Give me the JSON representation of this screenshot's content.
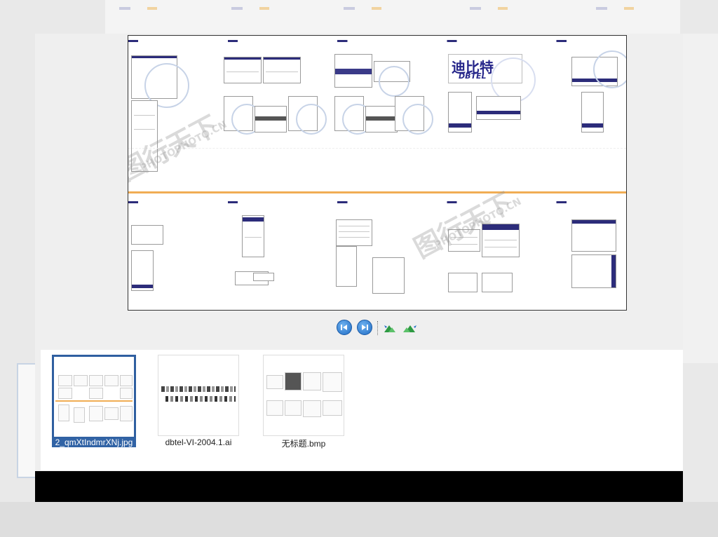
{
  "viewer": {
    "files": [
      {
        "name": "2_qmXtIndmrXNj.jpg",
        "selected": true
      },
      {
        "name": "dbtel-VI-2004.1.ai",
        "selected": false
      },
      {
        "name": "无标题.bmp",
        "selected": false
      }
    ],
    "controls": {
      "prev_icon": "previous-icon",
      "next_icon": "next-icon",
      "rotate_ccw_icon": "rotate-counterclockwise-icon",
      "rotate_cw_icon": "rotate-clockwise-icon"
    },
    "preview": {
      "brand_cn": "迪比特",
      "brand_en": "DBTEL"
    },
    "watermark": {
      "cn": "图行天下",
      "en": "PHOTOPHOTO.CN"
    }
  },
  "colors": {
    "selection": "#3163a5",
    "brand_blue": "#26268a",
    "accent_orange": "#f0ad54",
    "bottom_bar": "#000000"
  }
}
